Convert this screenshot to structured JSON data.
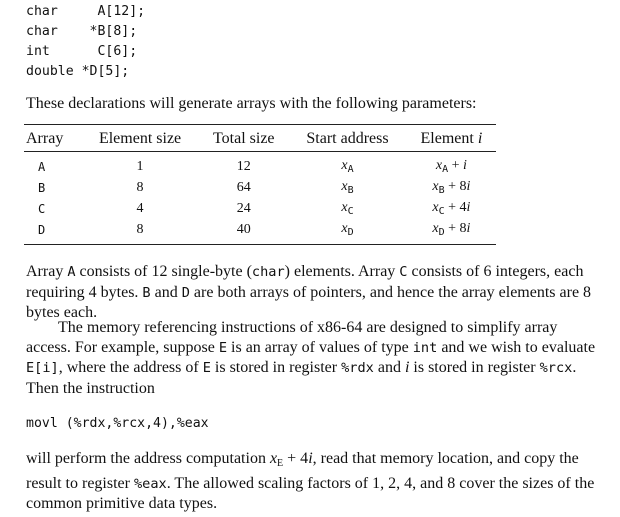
{
  "declarations": [
    "char     A[12];",
    "char    *B[8];",
    "int      C[6];",
    "double *D[5];"
  ],
  "intro": "These declarations will generate arrays with the following parameters:",
  "table": {
    "headers": [
      "Array",
      "Element size",
      "Total size",
      "Start address",
      "Element i"
    ],
    "rows": [
      {
        "array": "A",
        "element_size": "1",
        "total_size": "12",
        "start_address": "xA",
        "element_i": "xA + i"
      },
      {
        "array": "B",
        "element_size": "8",
        "total_size": "64",
        "start_address": "xB",
        "element_i": "xB + 8i"
      },
      {
        "array": "C",
        "element_size": "4",
        "total_size": "24",
        "start_address": "xC",
        "element_i": "xC + 4i"
      },
      {
        "array": "D",
        "element_size": "8",
        "total_size": "40",
        "start_address": "xD",
        "element_i": "xD + 8i"
      }
    ]
  },
  "p1": {
    "t1": "Array ",
    "c1": "A",
    "t2": " consists of 12 single-byte (",
    "c2": "char",
    "t3": ") elements. Array ",
    "c3": "C",
    "t4": " consists of 6 integers, each requiring 4 bytes. ",
    "c4": "B",
    "t5": " and ",
    "c5": "D",
    "t6": " are both arrays of pointers, and hence the array elements are 8 bytes each."
  },
  "p2": {
    "t1": "The memory referencing instructions of x86-64 are designed to simplify array access. For example, suppose ",
    "c1": "E",
    "t2": " is an array of values of type ",
    "c2": "int",
    "t3": " and we wish to evaluate ",
    "c3": "E[i]",
    "t4": ", where the address of ",
    "c4": "E",
    "t5": " is stored in register ",
    "c5": "%rdx",
    "t6": " and ",
    "m1": "i",
    "t7": " is stored in register ",
    "c6": "%rcx",
    "t8": ". Then the instruction"
  },
  "instruction": "movl (%rdx,%rcx,4),%eax",
  "p3": {
    "t1": "will perform the address computation ",
    "m1": "x",
    "m1sub": "E",
    "t2": " + 4",
    "m2": "i",
    "t3": ", read that memory location, and copy the result to register ",
    "c1": "%eax",
    "t4": ". The allowed scaling factors of 1, 2, 4, and 8 cover the sizes of the common primitive data types."
  }
}
